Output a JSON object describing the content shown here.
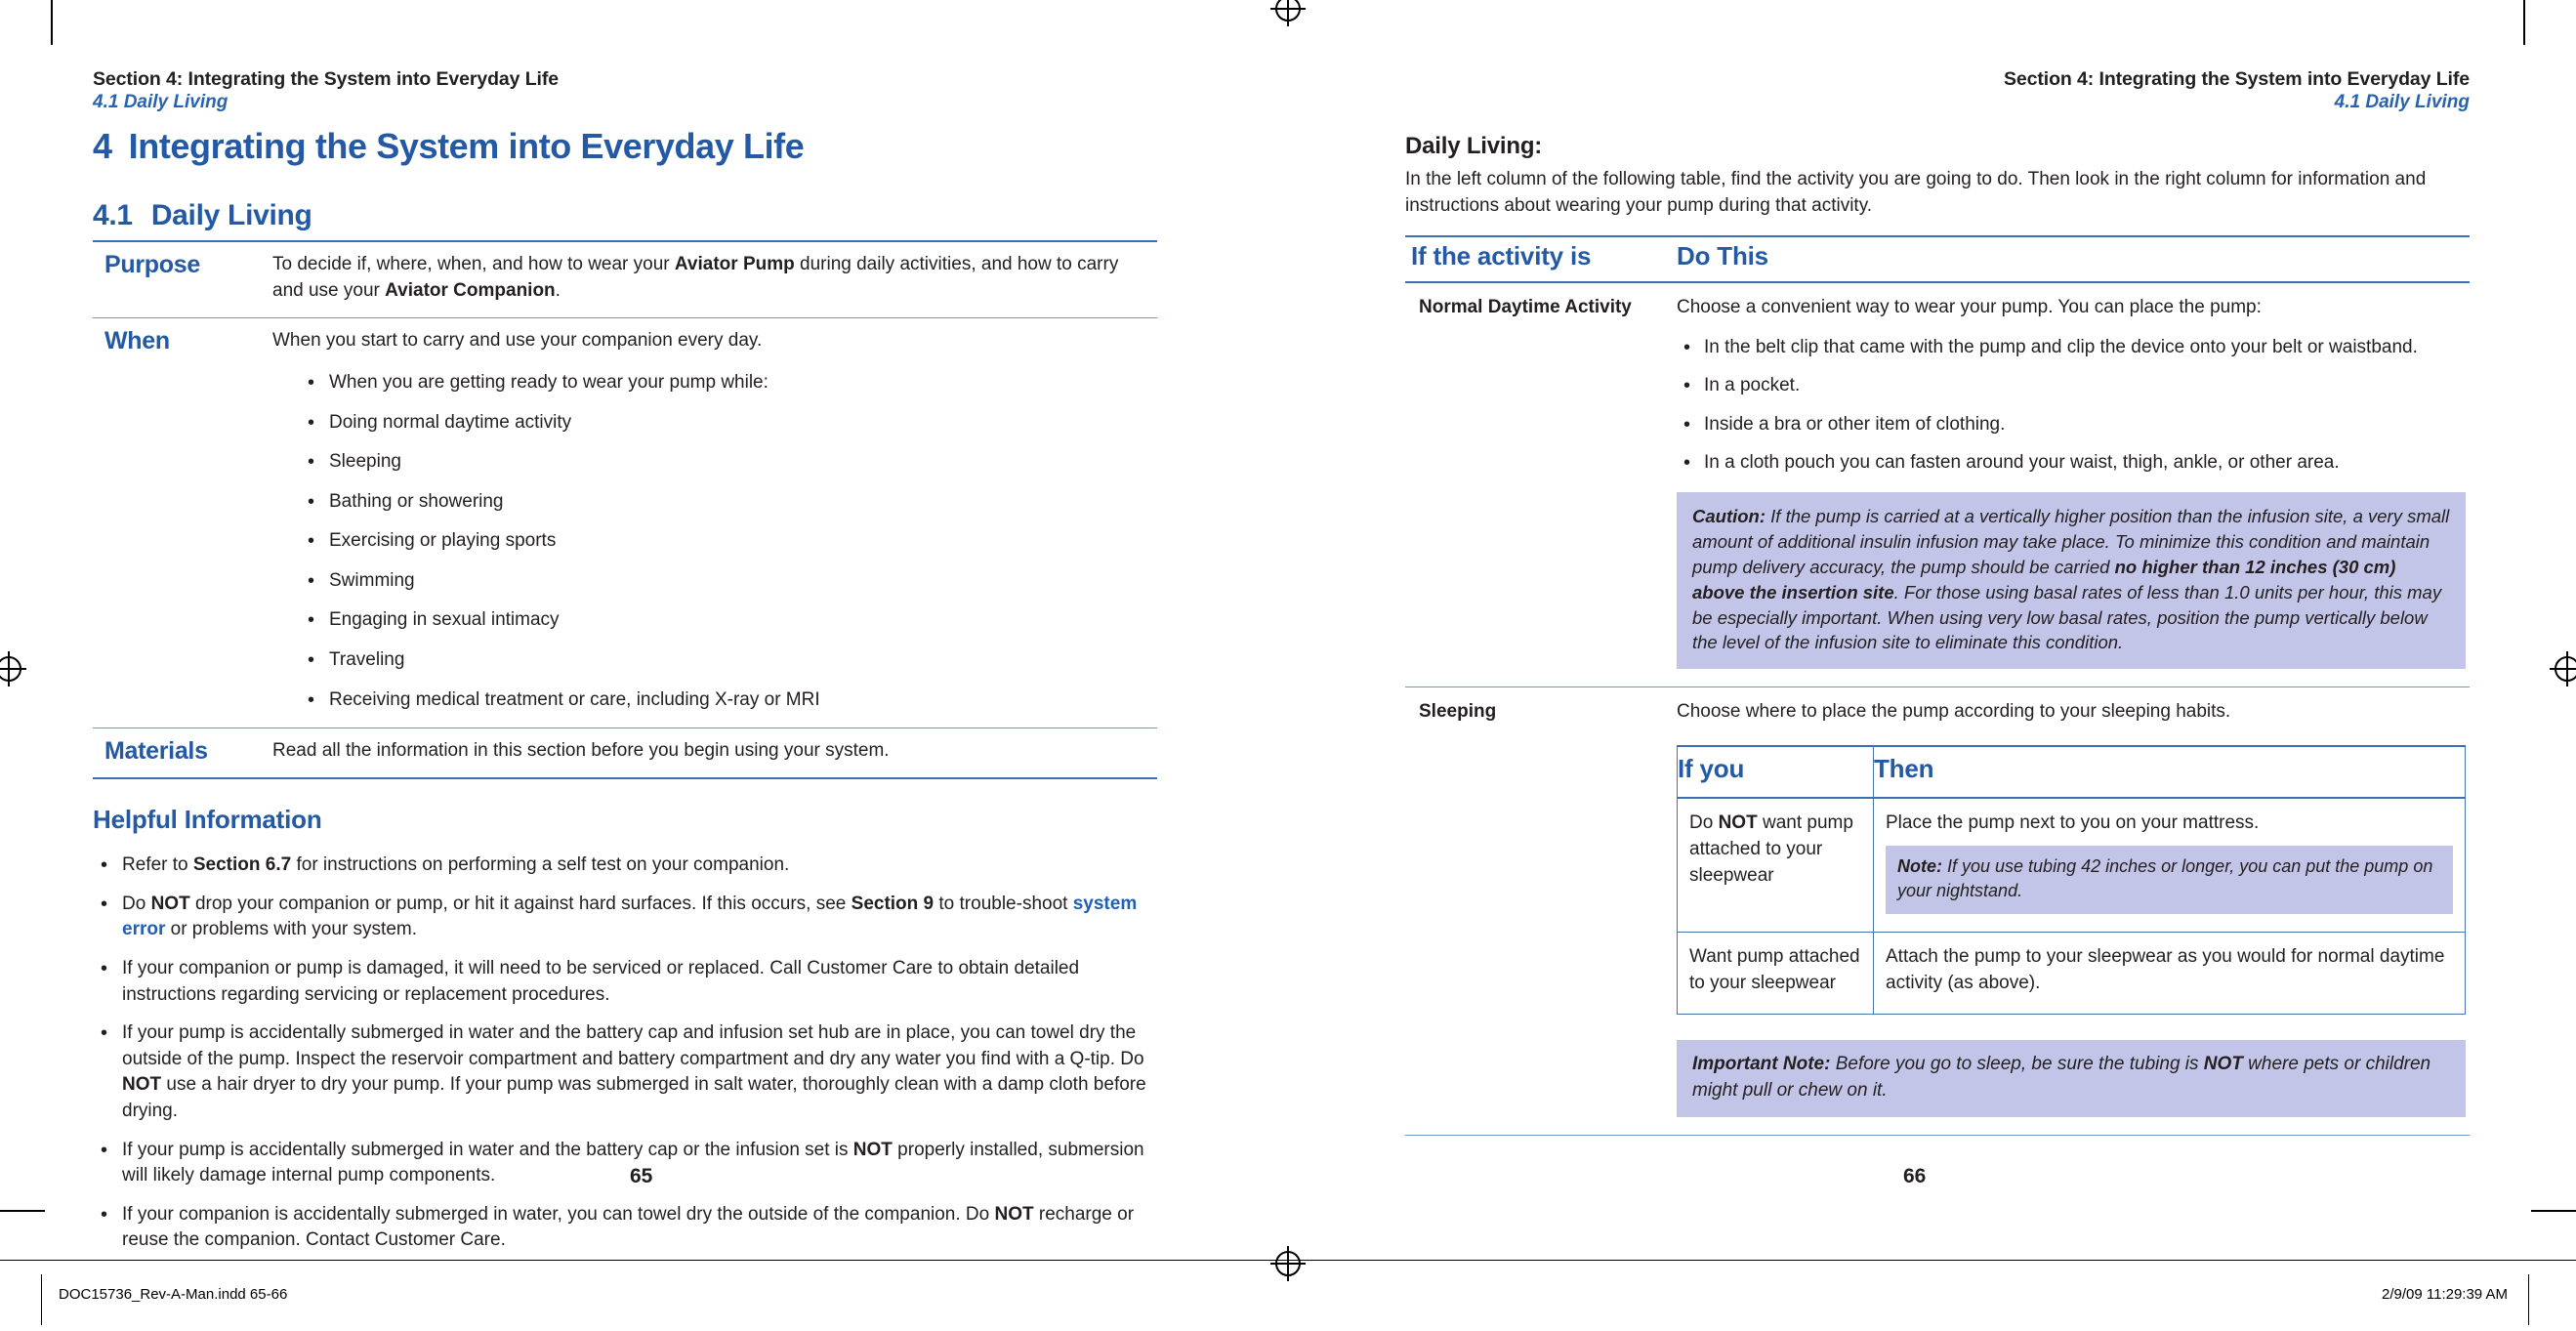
{
  "document": {
    "running_head_main": "Section 4: Integrating the System into Everyday Life",
    "running_head_sub": "4.1 Daily Living"
  },
  "left_page": {
    "page_number": "65",
    "section_number": "4",
    "section_title": "Integrating the System into Everyday Life",
    "subsection_number": "4.1",
    "subsection_title": "Daily Living",
    "pwm_table": {
      "purpose_label": "Purpose",
      "purpose_text_1": "To decide if, where, when, and how to wear your ",
      "purpose_bold_1": "Aviator Pump",
      "purpose_text_2": " during daily activities, and how to carry and use your ",
      "purpose_bold_2": "Aviator Companion",
      "purpose_text_3": ".",
      "when_label": "When",
      "when_text": "When you start to carry and use your companion every day.",
      "when_items": [
        "When you are getting ready to wear your pump while:",
        "Doing normal daytime activity",
        "Sleeping",
        "Bathing or showering",
        "Exercising or playing sports",
        "Swimming",
        "Engaging in sexual intimacy",
        "Traveling",
        "Receiving medical treatment or care, including X-ray or MRI"
      ],
      "materials_label": "Materials",
      "materials_text": "Read all the information in this section before you begin using your system."
    },
    "helpful_information": {
      "title": "Helpful Information",
      "bullets": [
        {
          "parts": [
            {
              "t": "Refer to ",
              "s": "n"
            },
            {
              "t": "Section 6.7",
              "s": "b"
            },
            {
              "t": " for instructions on performing a self test on your companion.",
              "s": "n"
            }
          ]
        },
        {
          "parts": [
            {
              "t": "Do ",
              "s": "n"
            },
            {
              "t": "NOT",
              "s": "b"
            },
            {
              "t": " drop your companion or pump, or hit it against hard surfaces. If this occurs, see ",
              "s": "n"
            },
            {
              "t": "Section 9",
              "s": "b"
            },
            {
              "t": " to trouble-shoot ",
              "s": "n"
            },
            {
              "t": "system error",
              "s": "bb"
            },
            {
              "t": " or problems with your system.",
              "s": "n"
            }
          ]
        },
        {
          "parts": [
            {
              "t": "If your companion or pump is damaged, it will need to be serviced or replaced. Call Customer Care to obtain detailed instructions regarding servicing or replacement procedures.",
              "s": "n"
            }
          ]
        },
        {
          "parts": [
            {
              "t": "If your pump is accidentally submerged in water and the battery cap and infusion set hub are in place, you can towel dry the outside of the pump. Inspect the reservoir compartment and battery compartment and dry any water you find with a Q-tip. Do ",
              "s": "n"
            },
            {
              "t": "NOT",
              "s": "b"
            },
            {
              "t": " use a hair dryer to dry your pump. If your pump was submerged in salt water, thoroughly clean with a damp cloth before drying.",
              "s": "n"
            }
          ]
        },
        {
          "parts": [
            {
              "t": "If your pump is accidentally submerged in water and the battery cap or the infusion set is ",
              "s": "n"
            },
            {
              "t": "NOT",
              "s": "b"
            },
            {
              "t": " properly installed, submersion will likely damage internal pump components.",
              "s": "n"
            }
          ]
        },
        {
          "parts": [
            {
              "t": "If your companion is accidentally submerged in water, you can towel dry the outside of the companion. Do ",
              "s": "n"
            },
            {
              "t": "NOT",
              "s": "b"
            },
            {
              "t": " recharge or reuse the companion. Contact Customer Care.",
              "s": "n"
            }
          ]
        }
      ]
    }
  },
  "right_page": {
    "page_number": "66",
    "intro_title": "Daily Living:",
    "intro_text": "In the left column of the following table, find the activity you are going to do. Then look in the right column for information and instructions about wearing your pump during that activity.",
    "activity_table": {
      "header_col1": "If the activity is",
      "header_col2": "Do This",
      "rows": [
        {
          "activity": "Normal Daytime Activity",
          "lead": "Choose a convenient way to wear your pump. You can place the pump:",
          "bullets": [
            "In the belt clip that came with the pump and clip the device onto your belt or waistband.",
            "In a pocket.",
            "Inside a bra or other item of clothing.",
            "In a cloth pouch you can fasten around your waist, thigh, ankle, or other area."
          ]
        },
        {
          "activity": "Sleeping",
          "lead": "Choose where to place the pump according to your sleeping habits."
        }
      ]
    },
    "caution_box": {
      "lead": "Caution:",
      "text_1": " If the pump is carried at a vertically higher position than the infusion site, a very small amount of additional insulin infusion may take place. To minimize this condition and maintain pump delivery accuracy, the pump should be carried ",
      "bold": "no higher than 12 inches (30 cm) above the insertion site",
      "text_2": ". For those using basal rates of less than 1.0 units per hour, this may be especially important. When using very low basal rates, position the pump vertically below the level of the infusion site to eliminate this condition."
    },
    "sleep_table": {
      "header_if": "If you",
      "header_then": "Then",
      "row1_if_1": "Do ",
      "row1_if_bold": "NOT",
      "row1_if_2": " want pump attached to your sleepwear",
      "row1_then": "Place the pump next to you on your mattress.",
      "row1_note_lead": "Note:",
      "row1_note_text": " If you use tubing 42 inches or longer, you can put the pump on your nightstand.",
      "row2_if": "Want pump attached to your sleepwear",
      "row2_then": "Attach the pump to your sleepwear as you would for normal daytime activity (as above)."
    },
    "important_note": {
      "lead": "Important Note:",
      "text_1": " Before you go to sleep, be sure the tubing is ",
      "bold": "NOT",
      "text_2": " where pets or children might pull or chew on it."
    }
  },
  "slug_bar": {
    "file_name": "DOC15736_Rev-A-Man.indd   65-66",
    "timestamp": "2/9/09   11:29:39 AM"
  }
}
